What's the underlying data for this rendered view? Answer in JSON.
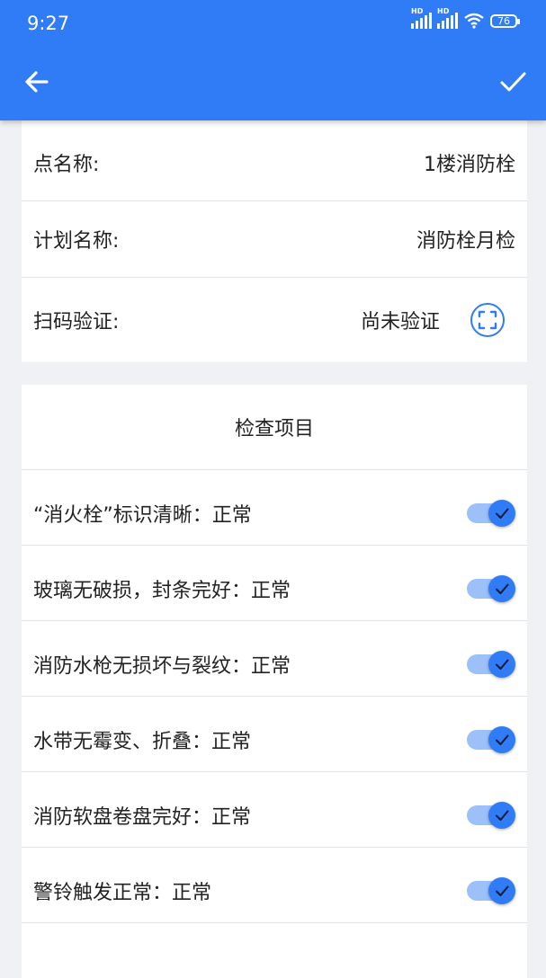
{
  "status_bar": {
    "time": "9:27",
    "network_1": "HD",
    "network_2": "HD",
    "battery": "76"
  },
  "toolbar": {
    "back_icon": "arrow-left-icon",
    "confirm_icon": "check-icon"
  },
  "info": {
    "point_name_label": "点名称:",
    "point_name_value": "1楼消防栓",
    "plan_name_label": "计划名称:",
    "plan_name_value": "消防栓月检",
    "scan_label": "扫码验证:",
    "scan_status": "尚未验证",
    "scan_icon": "scan-icon"
  },
  "check": {
    "title": "检查项目",
    "items": [
      {
        "text": "“消火栓”标识清晰：正常",
        "checked": true
      },
      {
        "text": "玻璃无破损，封条完好：正常",
        "checked": true
      },
      {
        "text": "消防水枪无损坏与裂纹：正常",
        "checked": true
      },
      {
        "text": "水带无霉变、折叠：正常",
        "checked": true
      },
      {
        "text": "消防软盘卷盘完好：正常",
        "checked": true
      },
      {
        "text": "警铃触发正常：正常",
        "checked": true
      }
    ]
  },
  "colors": {
    "accent": "#2f7cf6",
    "toggle_track": "#9cc0f8"
  }
}
